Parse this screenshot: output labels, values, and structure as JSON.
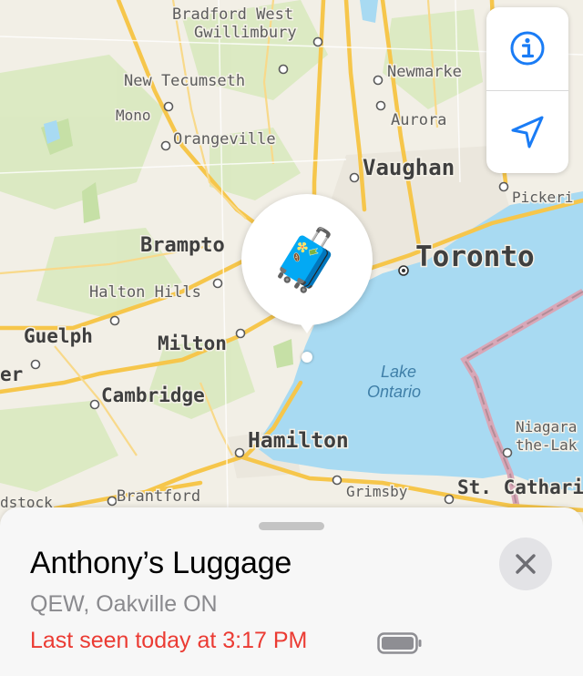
{
  "map": {
    "cities": [
      {
        "name": "Bradford West"
      },
      {
        "name": "Gwillimbury"
      },
      {
        "name": "Newmarke"
      },
      {
        "name": "New Tecumseth"
      },
      {
        "name": "Aurora"
      },
      {
        "name": "Mono"
      },
      {
        "name": "Orangeville"
      },
      {
        "name": "Vaughan"
      },
      {
        "name": "Pickeri"
      },
      {
        "name": "Brampto"
      },
      {
        "name": "Toronto"
      },
      {
        "name": "Halton Hills"
      },
      {
        "name": "Guelph"
      },
      {
        "name": "Milton"
      },
      {
        "name": "er"
      },
      {
        "name": "Cambridge"
      },
      {
        "name": "Hamilton"
      },
      {
        "name": "Niagara"
      },
      {
        "name": "the-Lak"
      },
      {
        "name": "dstock"
      },
      {
        "name": "Brantford"
      },
      {
        "name": "Grimsby"
      },
      {
        "name": "St. Cathari"
      }
    ],
    "lake_label_1": "Lake",
    "lake_label_2": "Ontario"
  },
  "controls": {
    "info_icon": "info-circle-icon",
    "location_icon": "location-arrow-icon",
    "accent": "#1a7cf5"
  },
  "item": {
    "emoji": "🧳",
    "title": "Anthony’s Luggage",
    "address": "QEW, Oakville ON",
    "last_seen": "Last seen today at 3:17 PM",
    "battery_icon": "battery-icon",
    "close_icon": "close-icon"
  },
  "colors": {
    "water": "#a8daf2",
    "land": "#f2efe6",
    "park": "#d6e8b8",
    "road": "#f6c64b",
    "status_red": "#eb3b33"
  }
}
